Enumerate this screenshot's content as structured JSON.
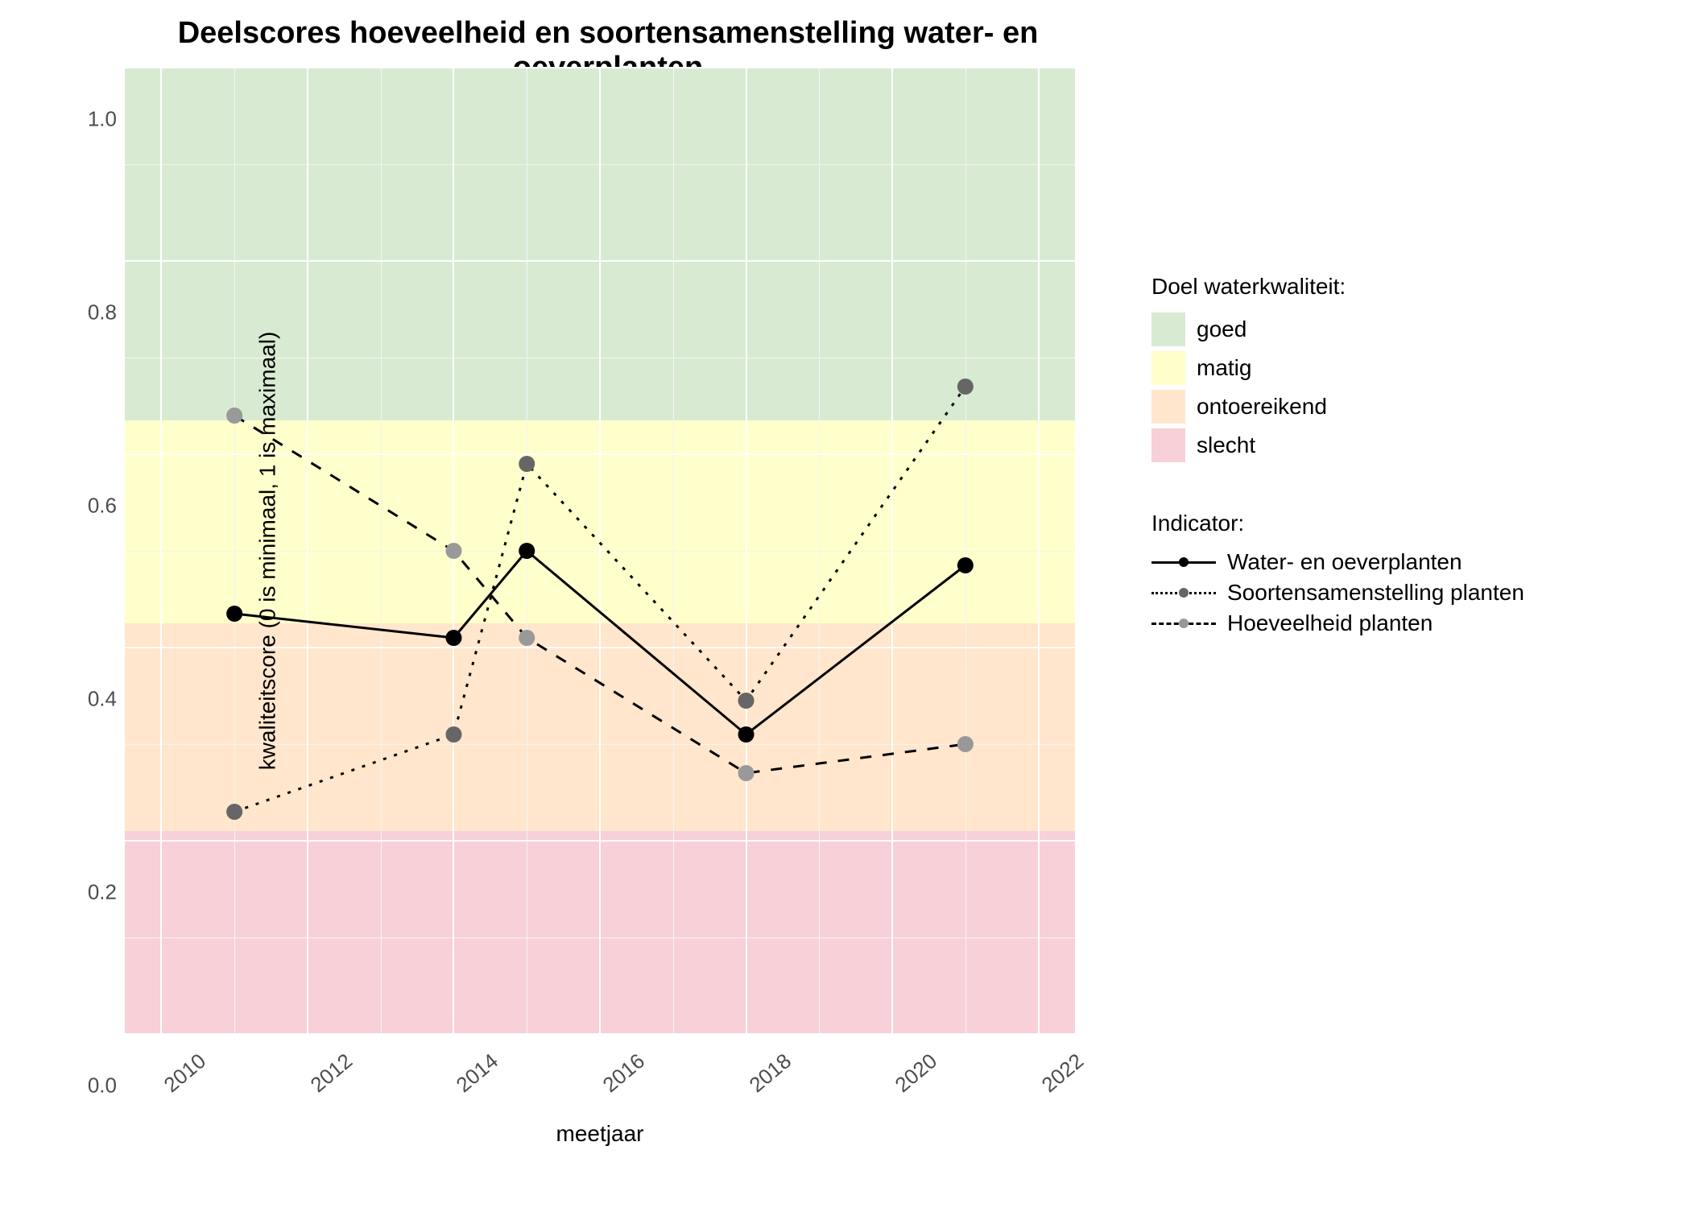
{
  "chart_data": {
    "type": "line",
    "title": "Deelscores hoeveelheid en soortensamenstelling water- en oeverplanten",
    "xlabel": "meetjaar",
    "ylabel": "kwaliteitscore (0 is minimaal, 1 is maximaal)",
    "xlim": [
      2009.5,
      2022.5
    ],
    "ylim": [
      0.0,
      1.0
    ],
    "xticks": [
      2010,
      2012,
      2014,
      2016,
      2018,
      2020,
      2022
    ],
    "yticks": [
      0.0,
      0.2,
      0.4,
      0.6,
      0.8,
      1.0
    ],
    "bands": [
      {
        "name": "goed",
        "from": 0.635,
        "to": 1.0,
        "color": "#d9ead3"
      },
      {
        "name": "matig",
        "from": 0.425,
        "to": 0.635,
        "color": "#ffffcc"
      },
      {
        "name": "ontoereikend",
        "from": 0.21,
        "to": 0.425,
        "color": "#ffe6cc"
      },
      {
        "name": "slecht",
        "from": 0.0,
        "to": 0.21,
        "color": "#f8d0d8"
      }
    ],
    "series": [
      {
        "name": "Water- en oeverplanten",
        "style": "solid",
        "color": "#000000",
        "x": [
          2011,
          2014,
          2015,
          2018,
          2021
        ],
        "y": [
          0.435,
          0.41,
          0.5,
          0.31,
          0.485
        ]
      },
      {
        "name": "Soortensamenstelling planten",
        "style": "dotted",
        "color": "#666666",
        "x": [
          2011,
          2014,
          2015,
          2018,
          2021
        ],
        "y": [
          0.23,
          0.31,
          0.59,
          0.345,
          0.67
        ]
      },
      {
        "name": "Hoeveelheid planten",
        "style": "dashed",
        "color": "#999999",
        "x": [
          2011,
          2014,
          2015,
          2018,
          2021
        ],
        "y": [
          0.64,
          0.5,
          0.41,
          0.27,
          0.3
        ]
      }
    ],
    "legend_quality_title": "Doel waterkwaliteit:",
    "legend_indicator_title": "Indicator:"
  }
}
